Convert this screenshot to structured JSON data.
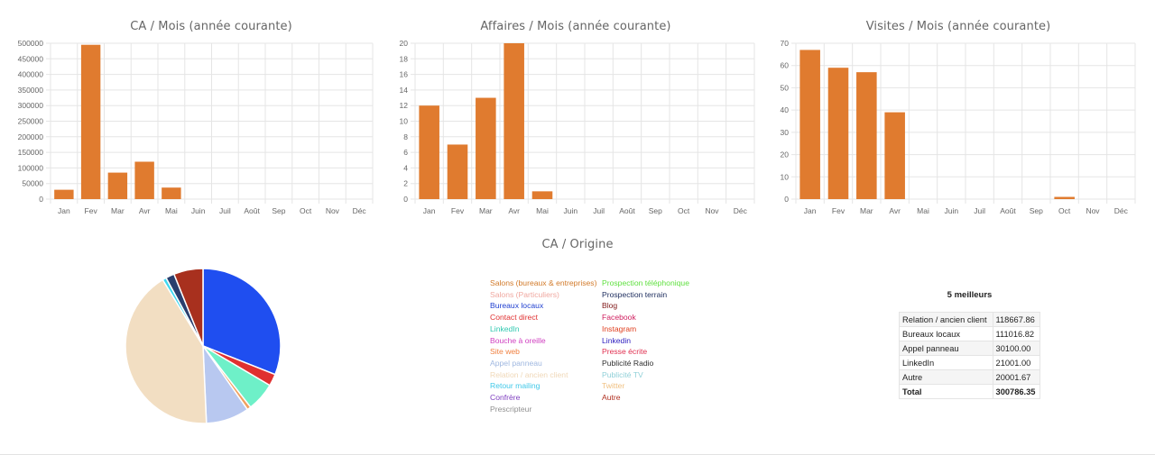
{
  "colors": {
    "bar": "#e07b2f",
    "grid": "#e5e5e5",
    "axis_text": "#666666"
  },
  "chart_data": [
    {
      "type": "bar",
      "title": "CA / Mois (année courante)",
      "categories": [
        "Jan",
        "Fev",
        "Mar",
        "Avr",
        "Mai",
        "Juin",
        "Juil",
        "Août",
        "Sep",
        "Oct",
        "Nov",
        "Déc"
      ],
      "values": [
        30000,
        495000,
        85000,
        120000,
        37000,
        0,
        0,
        0,
        0,
        0,
        0,
        0
      ],
      "ylim": [
        0,
        500000
      ],
      "yticks": [
        0,
        50000,
        100000,
        150000,
        200000,
        250000,
        300000,
        350000,
        400000,
        450000,
        500000
      ],
      "ytick_labels": [
        "0",
        "50000",
        "100000",
        "150000",
        "200000",
        "250000",
        "300000",
        "350000",
        "400000",
        "450000",
        "500000"
      ],
      "grid": true
    },
    {
      "type": "bar",
      "title": "Affaires / Mois (année courante)",
      "categories": [
        "Jan",
        "Fev",
        "Mar",
        "Avr",
        "Mai",
        "Juin",
        "Juil",
        "Août",
        "Sep",
        "Oct",
        "Nov",
        "Déc"
      ],
      "values": [
        12,
        7,
        13,
        20,
        1,
        0,
        0,
        0,
        0,
        0,
        0,
        0
      ],
      "ylim": [
        0,
        20
      ],
      "yticks": [
        0,
        2,
        4,
        6,
        8,
        10,
        12,
        14,
        16,
        18,
        20
      ],
      "ytick_labels": [
        "0",
        "2",
        "4",
        "6",
        "8",
        "10",
        "12",
        "14",
        "16",
        "18",
        "20"
      ],
      "grid": true
    },
    {
      "type": "bar",
      "title": "Visites / Mois (année courante)",
      "categories": [
        "Jan",
        "Fev",
        "Mar",
        "Avr",
        "Mai",
        "Juin",
        "Juil",
        "Août",
        "Sep",
        "Oct",
        "Nov",
        "Déc"
      ],
      "values": [
        67,
        59,
        57,
        39,
        0,
        0,
        0,
        0,
        0,
        1,
        0,
        0
      ],
      "ylim": [
        0,
        70
      ],
      "yticks": [
        0,
        10,
        20,
        30,
        40,
        50,
        60,
        70
      ],
      "ytick_labels": [
        "0",
        "10",
        "20",
        "30",
        "40",
        "50",
        "60",
        "70"
      ],
      "grid": true
    },
    {
      "type": "pie",
      "title": "CA / Origine",
      "slices": [
        {
          "label": "Bureaux locaux",
          "value": 31,
          "color": "#1f4ef0"
        },
        {
          "label": "Contact direct",
          "value": 2.5,
          "color": "#e03030"
        },
        {
          "label": "LinkedIn",
          "value": 6,
          "color": "#6ef0c8"
        },
        {
          "label": "Site web",
          "value": 0.8,
          "color": "#f0a060"
        },
        {
          "label": "Appel panneau",
          "value": 9,
          "color": "#b8c8f0"
        },
        {
          "label": "Relation / ancien client",
          "value": 42,
          "color": "#f2dec2"
        },
        {
          "label": "Retour mailing",
          "value": 0.8,
          "color": "#40d8f0"
        },
        {
          "label": "Publicité Radio",
          "value": 1.8,
          "color": "#2a3f6e"
        },
        {
          "label": "Autre",
          "value": 6.1,
          "color": "#a8301e"
        }
      ]
    }
  ],
  "legend": {
    "left": [
      {
        "label": "Salons (bureaux & entreprises)",
        "color": "#d27a2a"
      },
      {
        "label": "Salons (Particuliers)",
        "color": "#f0a8a0"
      },
      {
        "label": "Bureaux locaux",
        "color": "#1f3fd0"
      },
      {
        "label": "Contact direct",
        "color": "#e03030"
      },
      {
        "label": "LinkedIn",
        "color": "#30c8b0"
      },
      {
        "label": "Bouche à oreille",
        "color": "#d040c0"
      },
      {
        "label": "Site web",
        "color": "#f08040"
      },
      {
        "label": "Appel panneau",
        "color": "#a0b8e0"
      },
      {
        "label": "Relation / ancien client",
        "color": "#f0d8b8"
      },
      {
        "label": "Retour mailing",
        "color": "#40c8e8"
      },
      {
        "label": "Confrère",
        "color": "#8040c0"
      },
      {
        "label": "Prescripteur",
        "color": "#909090"
      }
    ],
    "right": [
      {
        "label": "Prospection téléphonique",
        "color": "#60e040"
      },
      {
        "label": "Prospection terrain",
        "color": "#203060"
      },
      {
        "label": "Blog",
        "color": "#801818"
      },
      {
        "label": "Facebook",
        "color": "#d02060"
      },
      {
        "label": "Instagram",
        "color": "#e04020"
      },
      {
        "label": "Linkedin",
        "color": "#3020c0"
      },
      {
        "label": "Presse écrite",
        "color": "#e03050"
      },
      {
        "label": "Publicité Radio",
        "color": "#303030"
      },
      {
        "label": "Publicité TV",
        "color": "#90d0d8"
      },
      {
        "label": "Twitter",
        "color": "#f0c080"
      },
      {
        "label": "Autre",
        "color": "#b03020"
      }
    ]
  },
  "top5": {
    "title": "5 meilleurs",
    "rows": [
      {
        "label": "Relation / ancien client",
        "value": "118667.86"
      },
      {
        "label": "Bureaux locaux",
        "value": "111016.82"
      },
      {
        "label": "Appel panneau",
        "value": "30100.00"
      },
      {
        "label": "LinkedIn",
        "value": "21001.00"
      },
      {
        "label": "Autre",
        "value": "20001.67"
      }
    ],
    "total": {
      "label": "Total",
      "value": "300786.35"
    }
  }
}
